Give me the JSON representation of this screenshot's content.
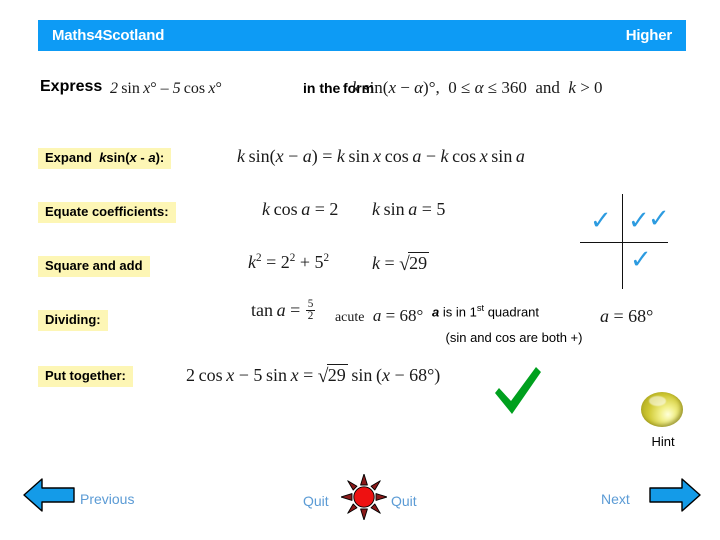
{
  "header": {
    "brand": "Maths4Scotland",
    "level": "Higher"
  },
  "question": {
    "express_label": "Express",
    "expression": "2 sin x° – 5 cos x°",
    "in_the_label": "in the",
    "form_label": "form",
    "form_expression": "k sin(x – α)°,  0 ≤ α ≤ 360  and  k > 0"
  },
  "steps": [
    {
      "label_prefix": "Expand  ",
      "label_italic_k": "k",
      "label_mid": "sin(",
      "label_italic_x": "x",
      "label_dash": " - ",
      "label_italic_a": "a",
      "label_suffix": "):",
      "label_plain": "Expand  ksin(x - a):",
      "math": "k sin(x − a) = k sin x cos a − k cos x sin a"
    },
    {
      "label_plain": "Equate coefficients:",
      "math_left": "k cos a = 2",
      "math_right": "k sin a = 5"
    },
    {
      "label_plain": "Square and add",
      "math_left": "k² = 2² + 5²",
      "math_right": "k = √29"
    },
    {
      "label_plain": "Dividing:",
      "math_tan": "tan a =",
      "frac_num": "5",
      "frac_den": "2",
      "math_acute_word": "acute",
      "math_acute_value": "a = 68°",
      "math_alpha": "a = 68°"
    },
    {
      "label_plain": "Put together:",
      "math": "2 cos x − 5 sin x = √29 sin(x − 68°)"
    }
  ],
  "annotation": {
    "line1_italic": "a",
    "line1_rest": " is in 1",
    "line1_sup": "st",
    "line1_tail": " quadrant",
    "line2": "(sin and cos are both +)"
  },
  "quadrant": {
    "check_glyph": "✓",
    "check_color": "#2C9BE0",
    "checks": [
      "quadrant-2",
      "quadrant-1-a",
      "quadrant-1-b",
      "quadrant-4"
    ]
  },
  "green_tick": {
    "color": "#00A01E",
    "name": "green-check"
  },
  "hint": {
    "label": "Hint"
  },
  "nav": {
    "previous": "Previous",
    "next": "Next",
    "quit_left": "Quit",
    "quit_right": "Quit"
  },
  "colors": {
    "banner_blue": "#0D9BF5",
    "highlight_yellow": "#FDF6B5",
    "link_blue": "#5B9BD5",
    "arrow_blue": "#149BE8",
    "quit_red": "#EE1111",
    "quit_spike": "#8B1A1A"
  }
}
